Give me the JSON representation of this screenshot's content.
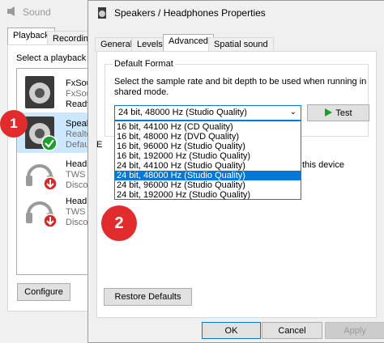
{
  "sound_window": {
    "title": "Sound",
    "tabs": [
      "Playback",
      "Recording"
    ],
    "instruction_fragment": "Select a playback d",
    "devices": [
      {
        "name": "FxSou",
        "line2": "FxSou",
        "line3": "Ready",
        "icon": "speaker-icon"
      },
      {
        "name": "Speak",
        "line2": "Realte",
        "line3": "Defau",
        "icon": "speaker-icon",
        "selected": true
      },
      {
        "name": "Heads",
        "line2": "TWS H",
        "line3": "Disco",
        "icon": "headphones-icon"
      },
      {
        "name": "Headp",
        "line2": "TWS S",
        "line3": "Disco",
        "icon": "headphones-icon"
      }
    ],
    "configure_label": "Configure"
  },
  "dialog": {
    "title": "Speakers / Headphones Properties",
    "tabs": [
      "General",
      "Levels",
      "Advanced",
      "Spatial sound"
    ],
    "active_tab": "Advanced",
    "group_label": "Default Format",
    "description": "Select the sample rate and bit depth to be used when running in shared mode.",
    "selected_format": "24 bit, 48000 Hz (Studio Quality)",
    "test_label": "Test",
    "format_options": [
      "16 bit, 44100 Hz (CD Quality)",
      "16 bit, 48000 Hz (DVD Quality)",
      "16 bit, 96000 Hz (Studio Quality)",
      "16 bit, 192000 Hz (Studio Quality)",
      "24 bit, 44100 Hz (Studio Quality)",
      "24 bit, 48000 Hz (Studio Quality)",
      "24 bit, 96000 Hz (Studio Quality)",
      "24 bit, 192000 Hz (Studio Quality)"
    ],
    "highlighted_index": 5,
    "exclusive_fragment": "this device",
    "exclusive_letter": "E",
    "restore_label": "Restore Defaults",
    "ok_label": "OK",
    "cancel_label": "Cancel",
    "apply_label": "Apply"
  },
  "badges": {
    "step1": "1",
    "step2": "2"
  },
  "colors": {
    "accent": "#0078d7",
    "badge": "#e02c2c",
    "selected_row": "#cce8ff",
    "test_arrow": "#1e9c2e"
  }
}
